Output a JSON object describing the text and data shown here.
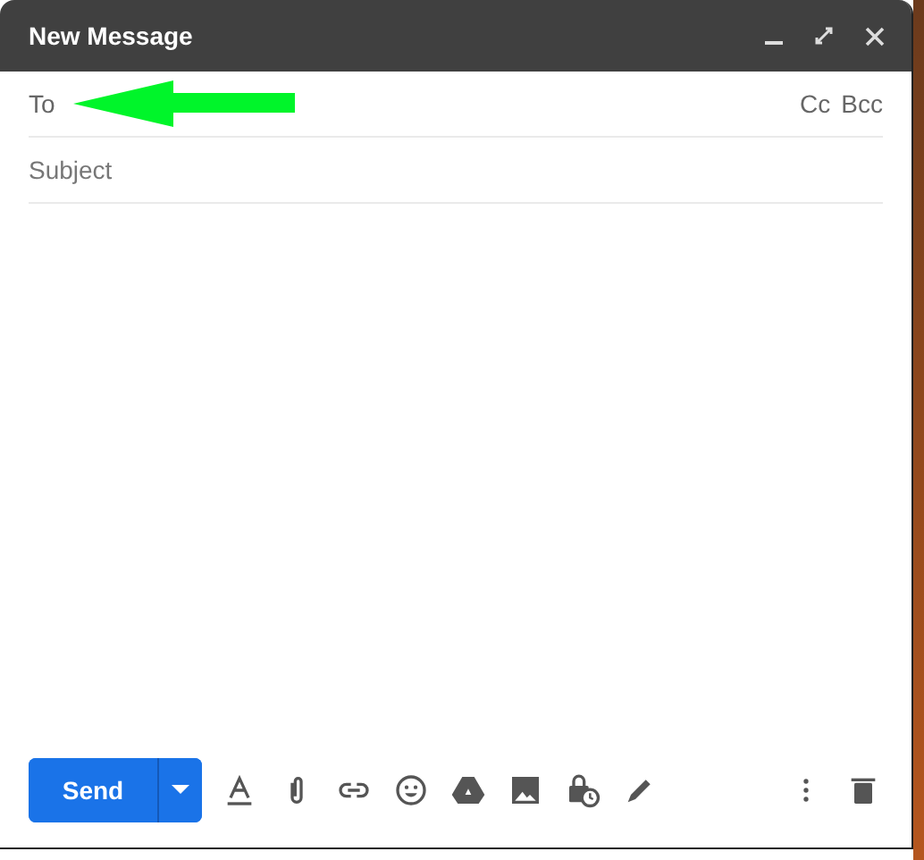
{
  "window": {
    "title": "New Message"
  },
  "recipients": {
    "label": "To",
    "links": [
      "Cc",
      "Bcc"
    ]
  },
  "subject": {
    "placeholder": "Subject"
  },
  "send_button": {
    "label": "Send"
  }
}
